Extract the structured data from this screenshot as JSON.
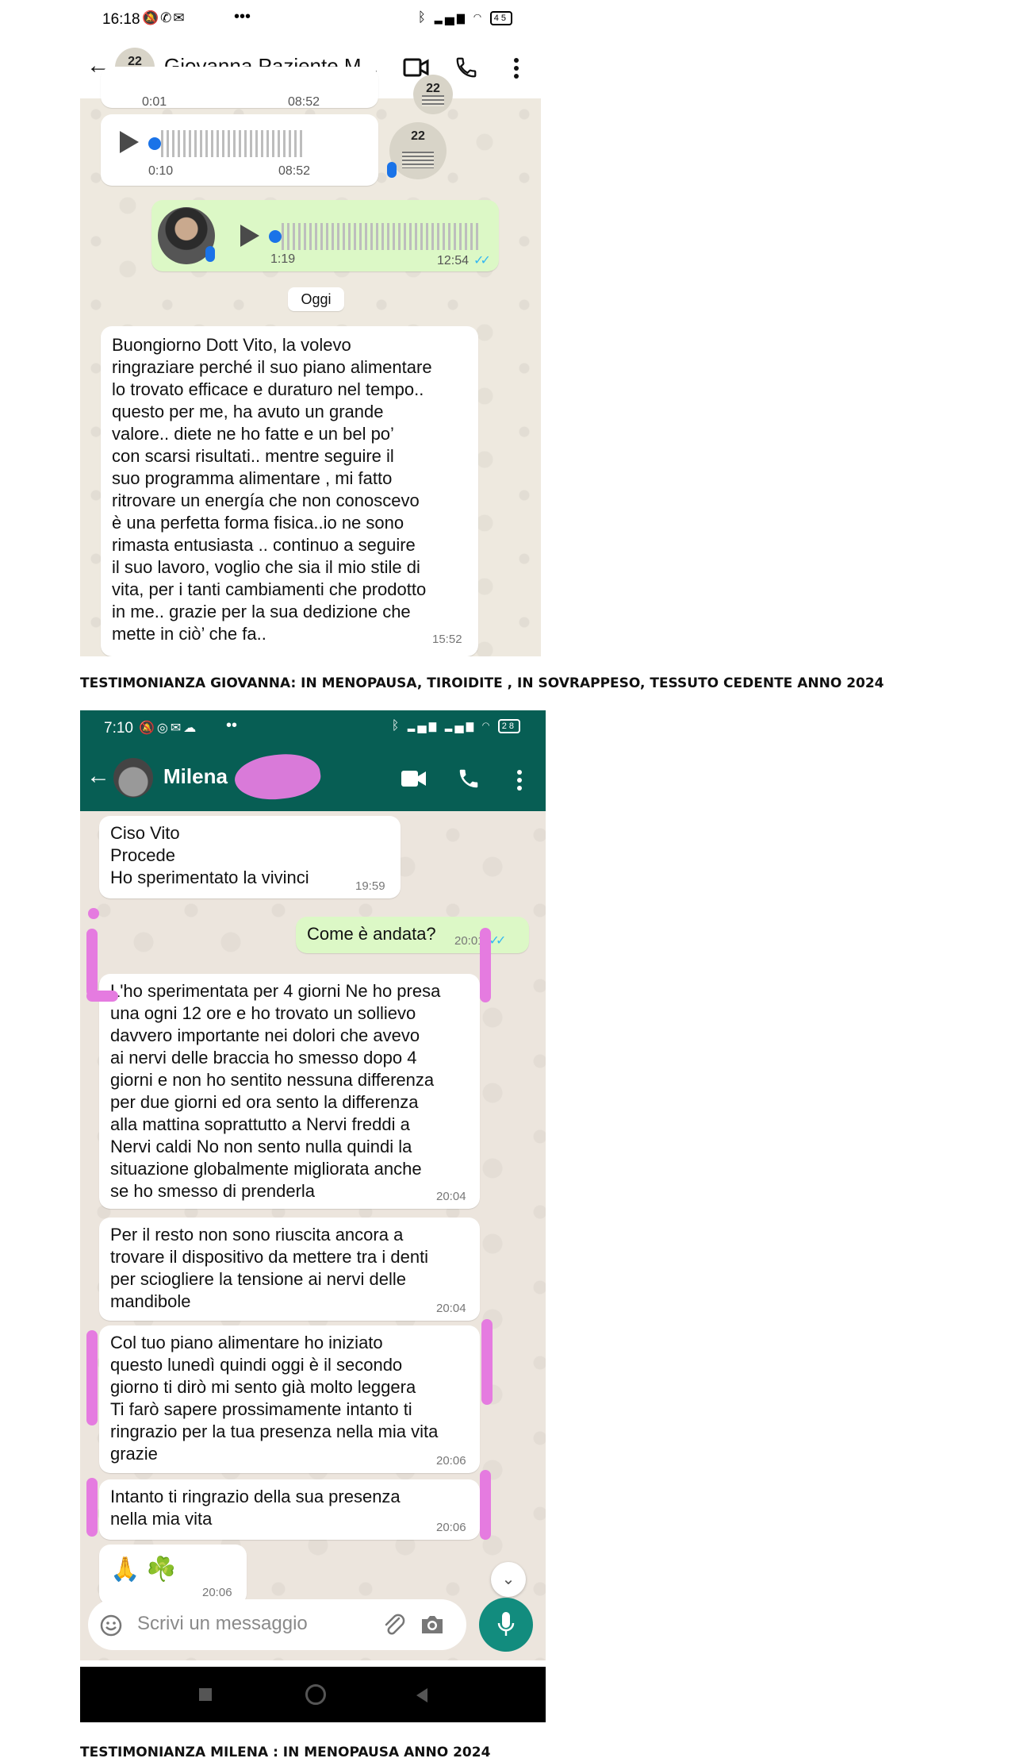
{
  "shot1": {
    "status": {
      "time": "16:18",
      "battery": "45"
    },
    "header": {
      "contact_name": "Giovanna Paziente M..."
    },
    "voice_partial": {
      "elapsed": "0:01",
      "time": "08:52"
    },
    "voice_1": {
      "elapsed": "0:10",
      "time": "08:52"
    },
    "voice_2": {
      "elapsed": "1:19",
      "time": "12:54"
    },
    "date_separator": "Oggi",
    "message": {
      "text": "Buongiorno  Dott Vito, la volevo\nringraziare perché il suo piano alimentare\nlo trovato efficace e duraturo nel tempo..\nquesto per me, ha avuto  un grande\nvalore.. diete ne ho fatte e un bel po’\ncon scarsi risultati.. mentre seguire il\nsuo programma alimentare , mi fatto\nritrovare un energía che non conoscevo\nè una perfetta forma fisica..io ne sono\nrimasta entusiasta .. continuo a seguire\nil suo lavoro, voglio  che sia il mio stile di\nvita, per i tanti cambiamenti che prodotto\nin me.. grazie per la sua dedizione che\nmette in ciò’ che fa..",
      "time": "15:52"
    }
  },
  "caption1": "TESTIMONIANZA GIOVANNA: IN MENOPAUSA, TIROIDITE , IN SOVRAPPESO, TESSUTO CEDENTE ANNO 2024",
  "shot2": {
    "status": {
      "time": "7:10",
      "battery": "28"
    },
    "header": {
      "contact_name": "Milena"
    },
    "messages": [
      {
        "text": "Ciso Vito\nProcede\n Ho sperimentato  la vivinci",
        "time": "19:59"
      },
      {
        "text": "Come è andata?",
        "time": "20:01"
      },
      {
        "text": "L'ho sperimentata per 4 giorni Ne ho presa\nuna ogni 12 ore e ho trovato un sollievo\ndavvero importante nei dolori che avevo\nai nervi delle braccia ho smesso dopo 4\ngiorni e non ho sentito nessuna differenza\nper due giorni ed ora sento la differenza\nalla mattina soprattutto a Nervi freddi a\nNervi caldi No non sento nulla quindi la\nsituazione globalmente migliorata anche\nse ho smesso di prenderla",
        "time": "20:04"
      },
      {
        "text": "Per il resto non sono riuscita ancora a\ntrovare il dispositivo da mettere tra i denti\nper sciogliere la tensione ai nervi delle\nmandibole",
        "time": "20:04"
      },
      {
        "text": "Col tuo piano alimentare ho iniziato\nquesto lunedì quindi oggi è il secondo\ngiorno ti dirò mi sento già molto leggera\nTi farò sapere prossimamente intanto ti\nringrazio per la tua presenza nella mia vita\ngrazie",
        "time": "20:06"
      },
      {
        "text": "Intanto ti ringrazio della sua presenza\nnella mia vita",
        "time": "20:06"
      },
      {
        "text": "🙏 ☘️",
        "time": "20:06"
      }
    ],
    "input_placeholder": "Scrivi un messaggio"
  },
  "caption2": "TESTIMONIANZA MILENA : IN MENOPAUSA ANNO 2024",
  "colors": {
    "whatsapp_dark": "#075e54",
    "whatsapp_accent": "#128c7e",
    "outgoing_bubble": "#dcf8c6",
    "highlight_pink": "#e57be0",
    "read_ticks": "#34b7f1"
  }
}
